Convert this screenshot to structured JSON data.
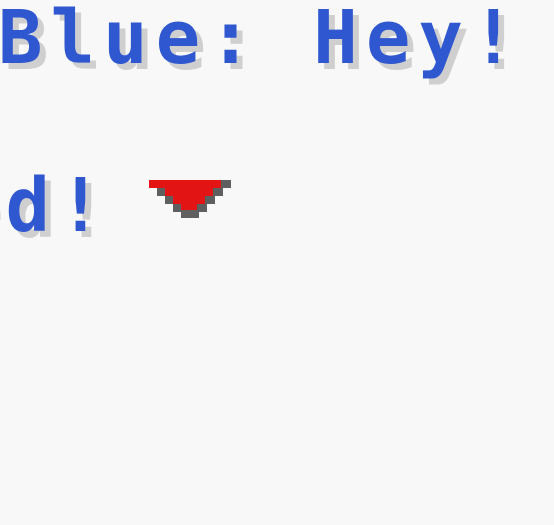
{
  "dialog": {
    "line_1": "Blue: Hey! R",
    "line_2": "ed!"
  },
  "colors": {
    "background": "#f8f8f8",
    "text": "#2f57d0",
    "text_shadow": "#cfcfcf",
    "arrow_fill": "#e31414",
    "arrow_shadow": "#5f5f5f"
  },
  "icons": {
    "advance": "continue-arrow-icon"
  }
}
